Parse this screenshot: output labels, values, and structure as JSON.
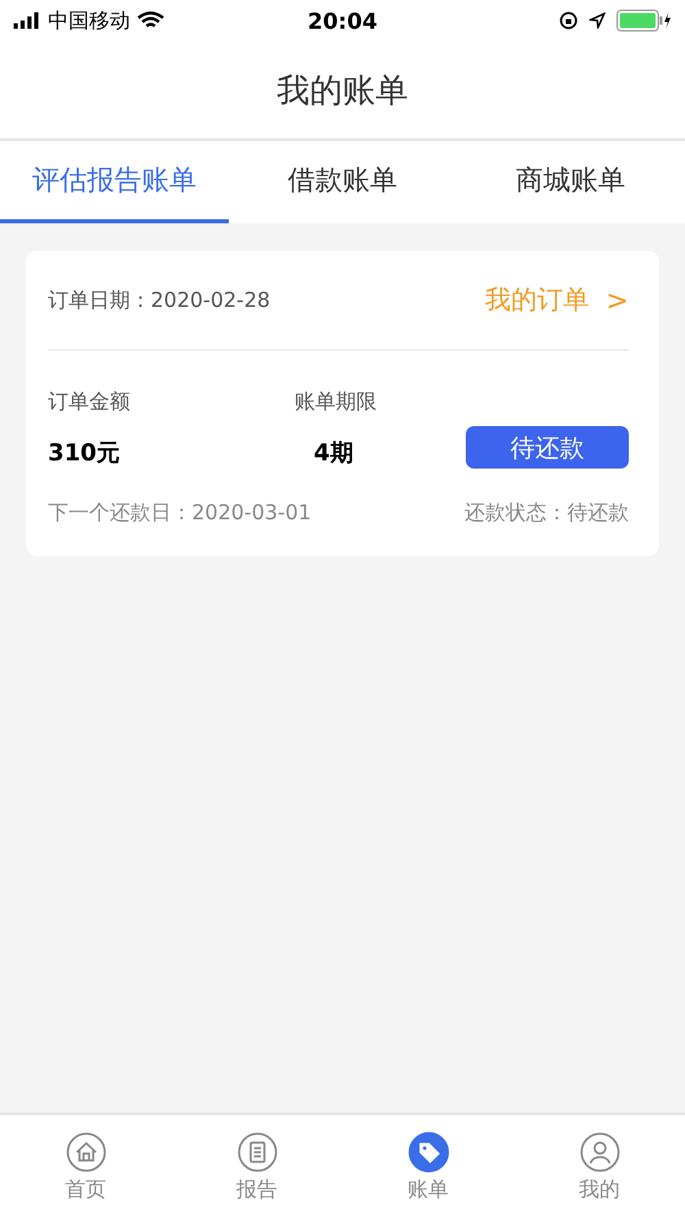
{
  "status_bar": {
    "carrier": "中国移动",
    "time": "20:04"
  },
  "header": {
    "title": "我的账单"
  },
  "tabs": [
    {
      "label": "评估报告账单",
      "selected": true
    },
    {
      "label": "借款账单",
      "selected": false
    },
    {
      "label": "商城账单",
      "selected": false
    }
  ],
  "bill": {
    "date_label": "订单日期：",
    "date": "2020-02-28",
    "link": "我的订单",
    "link_arrow": ">",
    "amount_label": "订单金额",
    "amount": "310元",
    "term_label": "账单期限",
    "term": "4期",
    "button": "待还款",
    "next_label": "下一个还款日：",
    "next_date": "2020-03-01",
    "status_label": "还款状态：",
    "status": "待还款"
  },
  "nav": [
    {
      "label": "首页",
      "kind": "home",
      "selected": false
    },
    {
      "label": "报告",
      "kind": "report",
      "selected": false
    },
    {
      "label": "账单",
      "kind": "bill",
      "selected": true
    },
    {
      "label": "我的",
      "kind": "me",
      "selected": false
    }
  ]
}
